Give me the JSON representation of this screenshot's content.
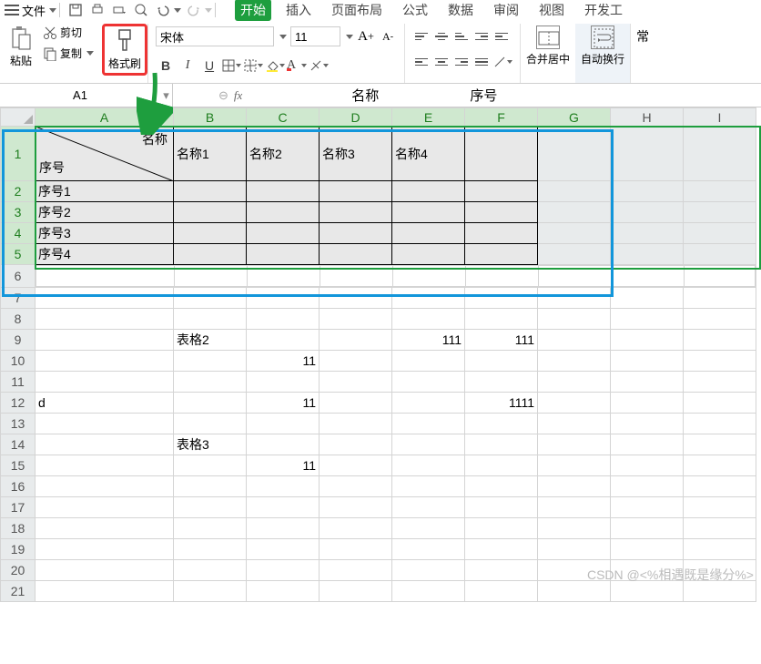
{
  "menu": {
    "file": "文件",
    "tabs": [
      "开始",
      "插入",
      "页面布局",
      "公式",
      "数据",
      "审阅",
      "视图",
      "开发工"
    ],
    "extra": "常"
  },
  "clipboard": {
    "paste": "粘贴",
    "cut": "剪切",
    "copy": "复制",
    "brush": "格式刷"
  },
  "font": {
    "name": "宋体",
    "size": "11"
  },
  "merge": "合并居中",
  "wrap": "自动换行",
  "nameBox": "A1",
  "formulaParts": [
    "名称",
    "序号"
  ],
  "diag": {
    "tr": "名称",
    "bl": "序号"
  },
  "colHeaders": [
    "A",
    "B",
    "C",
    "D",
    "E",
    "F",
    "G",
    "H",
    "I"
  ],
  "rowHeaders": [
    "1",
    "2",
    "3",
    "4",
    "5",
    "6",
    "7",
    "8",
    "9",
    "10",
    "11",
    "12",
    "13",
    "14",
    "15",
    "16",
    "17",
    "18",
    "19",
    "20",
    "21"
  ],
  "table1": {
    "headers": [
      "名称1",
      "名称2",
      "名称3",
      "名称4"
    ],
    "rows": [
      "序号1",
      "序号2",
      "序号3",
      "序号4"
    ]
  },
  "cells": {
    "B9": "表格2",
    "E9": "111",
    "F9": "111",
    "C10": "11",
    "A12": "d",
    "C12": "11",
    "F12": "1111",
    "B14": "表格3",
    "C15": "11"
  },
  "watermark": "CSDN @<%相遇既是缘分%>"
}
